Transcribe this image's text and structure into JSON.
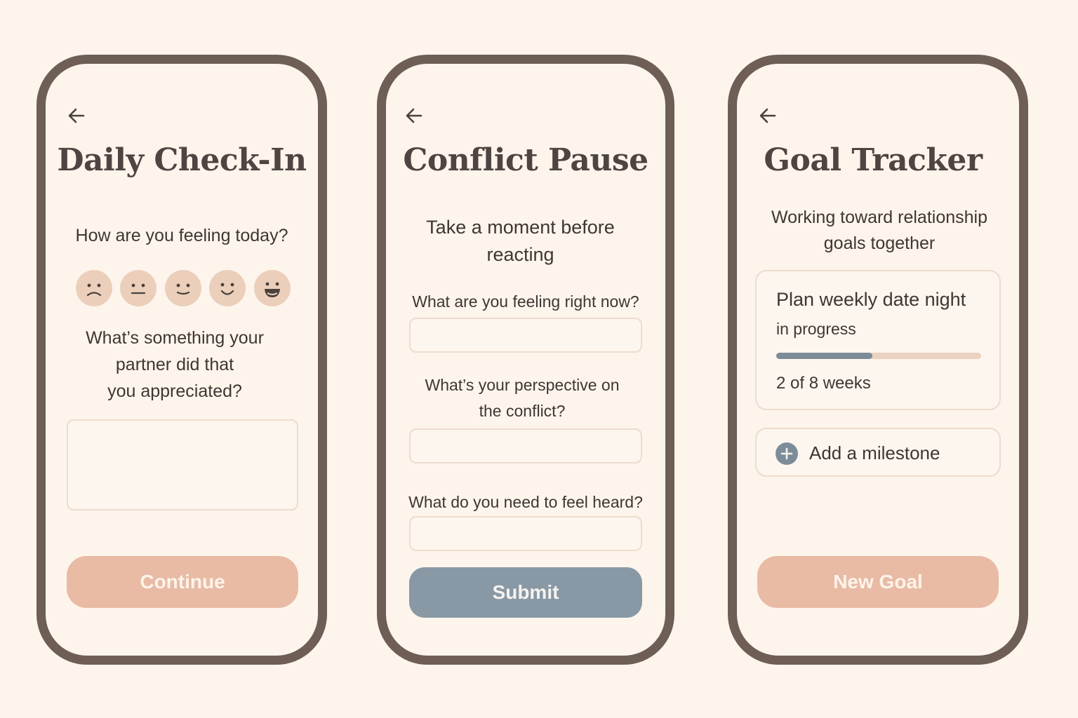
{
  "colors": {
    "background": "#fdf5ec",
    "phone_frame": "#6e5e55",
    "peach_button": "#e9bba4",
    "blue_button": "#8898a5",
    "mood_face": "#ebcfbb",
    "progress_fill": "#7d8c99",
    "progress_track": "#ecd0c0"
  },
  "checkin": {
    "back_icon": "arrow-left-icon",
    "title": "Daily Check-In",
    "mood_question": "How are you feeling today?",
    "moods": [
      "very-sad-face-icon",
      "neutral-face-icon",
      "slight-smile-face-icon",
      "smile-face-icon",
      "happy-face-icon"
    ],
    "appreciation_question": {
      "line1": "What’s something your",
      "line2": "partner did that",
      "line3": "you appreciated?"
    },
    "appreciation_value": "",
    "continue_label": "Continue"
  },
  "conflict": {
    "back_icon": "arrow-left-icon",
    "title": "Conflict Pause",
    "subtitle": {
      "line1": "Take a moment before",
      "line2": "reacting"
    },
    "q1": "What are you feeling right now?",
    "q1_value": "",
    "q2": {
      "line1": "What’s your perspective on",
      "line2": "the conflict?"
    },
    "q2_value": "",
    "q3": "What do you need to feel heard?",
    "q3_value": "",
    "submit_label": "Submit"
  },
  "goals": {
    "back_icon": "arrow-left-icon",
    "title": "Goal Tracker",
    "subtitle": {
      "line1": "Working toward relationship",
      "line2": "goals together"
    },
    "goal": {
      "name": "Plan weekly date night",
      "status": "in progress",
      "progress_fraction": 0.47,
      "progress_text": "2 of 8 weeks"
    },
    "add_milestone_icon": "plus-circle-icon",
    "add_milestone_label": "Add a milestone",
    "new_goal_label": "New Goal"
  }
}
